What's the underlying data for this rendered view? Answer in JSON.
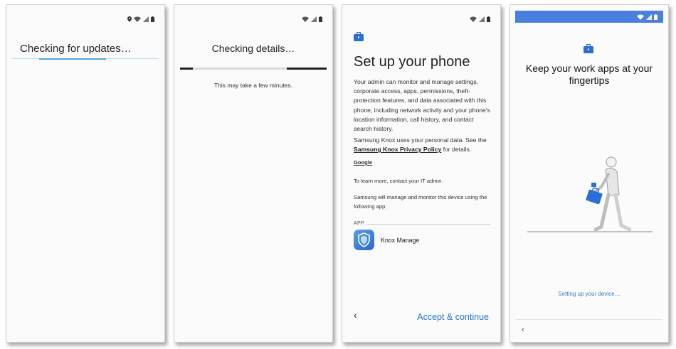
{
  "screen1": {
    "title": "Checking for updates…"
  },
  "screen2": {
    "title": "Checking details…",
    "note": "This may take a few minutes."
  },
  "screen3": {
    "title": "Set up your phone",
    "paragraph1": "Your admin can monitor and manage settings, corporate access, apps, permissions, theft-protection features, and data associated with this phone, including network activity and your phone's location information, call history, and contact search history.",
    "paragraph2_pre": "Samsung Knox uses your personal data. See the",
    "paragraph2_link": "Samsung Knox Privacy Policy",
    "paragraph2_post": "for details.",
    "google_link": "Google",
    "it_admin": "To learn more, contact your IT admin.",
    "manage_text": "Samsung will manage and monitor this device using the following app:",
    "app_section_label": "APP",
    "app_name": "Knox Manage",
    "back_icon": "‹",
    "accept_button": "Accept & continue"
  },
  "screen4": {
    "title": "Keep your work apps at your fingertips",
    "status_text": "Setting up your device…",
    "back_icon": "‹"
  },
  "colors": {
    "accent_blue": "#2b77c8",
    "progress_blue": "#4fa7dc",
    "status_bar_blue": "#4a7fe0",
    "briefcase_blue": "#2b6fd6"
  }
}
